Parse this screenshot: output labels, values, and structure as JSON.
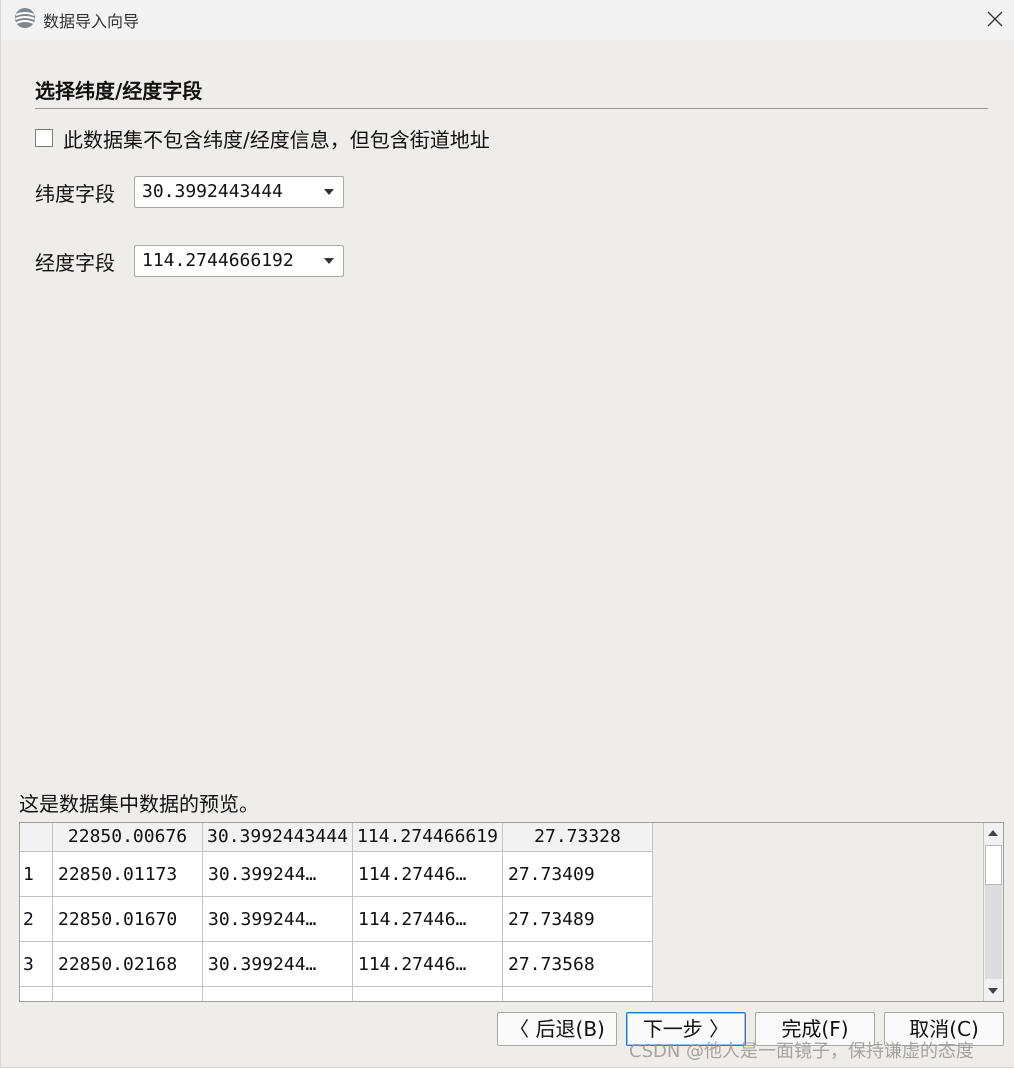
{
  "window": {
    "title": "数据导入向导"
  },
  "section": {
    "title": "选择纬度/经度字段"
  },
  "street_checkbox": {
    "label": "此数据集不包含纬度/经度信息，但包含街道地址",
    "checked": false
  },
  "latitude": {
    "label": "纬度字段",
    "selected": "30.3992443444"
  },
  "longitude": {
    "label": "经度字段",
    "selected": "114.2744666192"
  },
  "preview": {
    "label": "这是数据集中数据的预览。",
    "headers": [
      "22850.00676",
      "30.3992443444",
      "114.274466619",
      "27.73328"
    ],
    "rows": [
      {
        "num": "1",
        "cells": [
          "22850.01173",
          "30.399244…",
          "114.27446…",
          "27.73409"
        ]
      },
      {
        "num": "2",
        "cells": [
          "22850.01670",
          "30.399244…",
          "114.27446…",
          "27.73489"
        ]
      },
      {
        "num": "3",
        "cells": [
          "22850.02168",
          "30.399244…",
          "114.27446…",
          "27.73568"
        ]
      }
    ]
  },
  "buttons": {
    "back": "〈 后退(B)",
    "next": "下一步 〉",
    "finish": "完成(F)",
    "cancel": "取消(C)"
  },
  "watermark": "CSDN @他人是一面镜子，保持谦虚的态度",
  "colors": {
    "background": "#efedea",
    "titlebar": "#f3f3f3",
    "primary_border": "#2a74c9"
  },
  "icons": {
    "app": "globe-icon",
    "close": "close-icon",
    "combo_arrow": "triangle-down-icon",
    "scroll_up": "triangle-up-icon",
    "scroll_down": "triangle-down-icon"
  }
}
